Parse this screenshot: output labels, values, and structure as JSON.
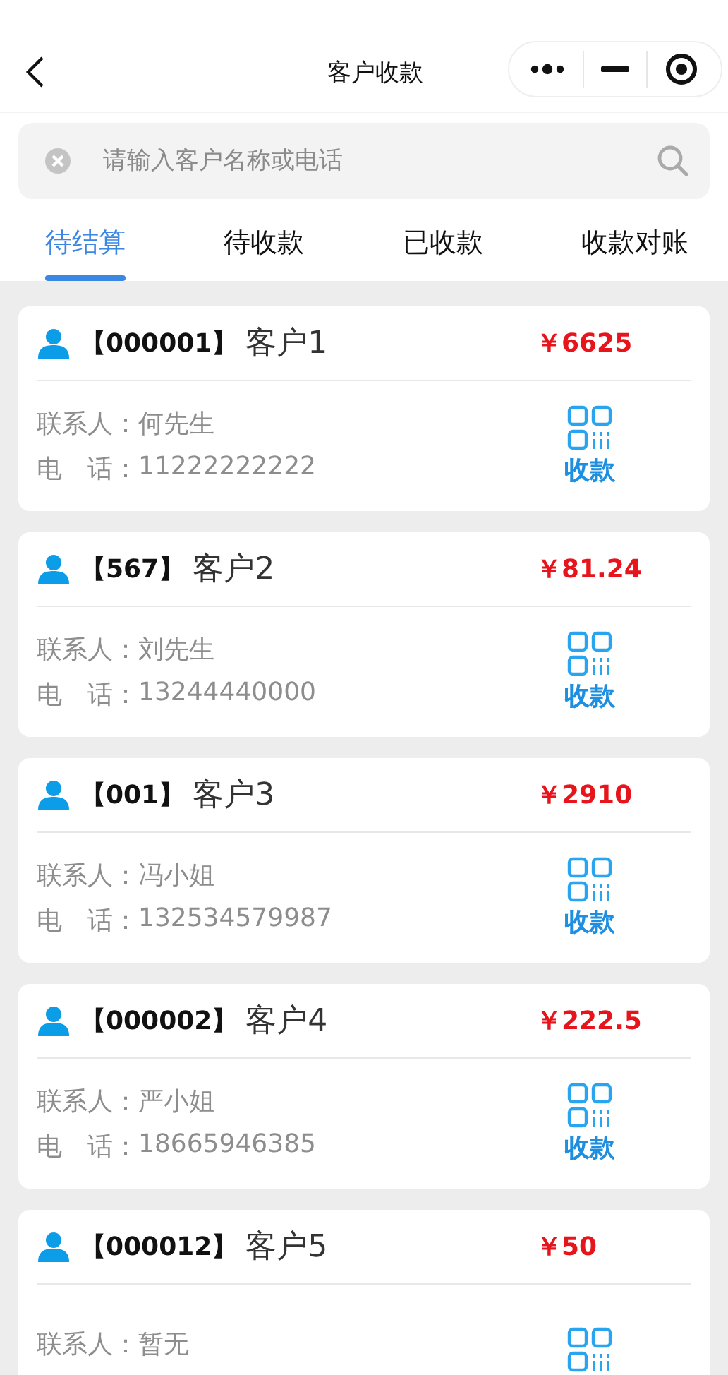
{
  "nav": {
    "title": "客户收款"
  },
  "search": {
    "placeholder": "请输入客户名称或电话"
  },
  "tabs": [
    {
      "label": "待结算",
      "selected": true
    },
    {
      "label": "待收款",
      "selected": false
    },
    {
      "label": "已收款",
      "selected": false
    },
    {
      "label": "收款对账",
      "selected": false
    }
  ],
  "customers": [
    {
      "code": "【000001】",
      "name": "客户1",
      "amount": "￥6625",
      "contact_label": "联系人：",
      "contact": "何先生",
      "phone_label": "电　话：",
      "phone": "11222222222",
      "action": "收款"
    },
    {
      "code": "【567】",
      "name": "客户2",
      "amount": "￥81.24",
      "contact_label": "联系人：",
      "contact": "刘先生",
      "phone_label": "电　话：",
      "phone": "13244440000",
      "action": "收款"
    },
    {
      "code": "【001】",
      "name": "客户3",
      "amount": "￥2910",
      "contact_label": "联系人：",
      "contact": "冯小姐",
      "phone_label": "电　话：",
      "phone": "132534579987",
      "action": "收款"
    },
    {
      "code": "【000002】",
      "name": "客户4",
      "amount": "￥222.5",
      "contact_label": "联系人：",
      "contact": "严小姐",
      "phone_label": "电　话：",
      "phone": "18665946385",
      "action": "收款"
    },
    {
      "code": "【000012】",
      "name": "客户5",
      "amount": "￥50",
      "contact_label": "联系人：",
      "contact": "暂无"
    }
  ]
}
